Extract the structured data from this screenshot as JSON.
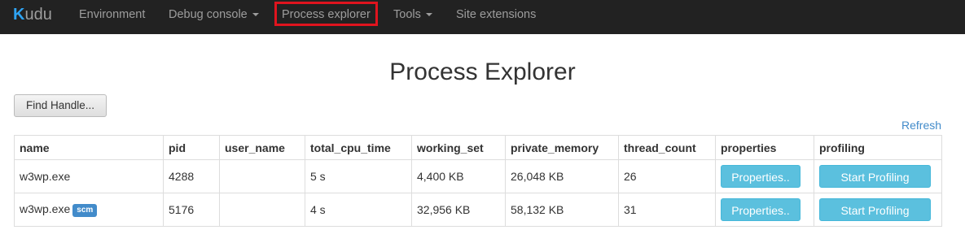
{
  "navbar": {
    "brand_k": "K",
    "brand_rest": "udu",
    "items": [
      {
        "label": "Environment",
        "dropdown": false
      },
      {
        "label": "Debug console",
        "dropdown": true
      },
      {
        "label": "Process explorer",
        "dropdown": false,
        "highlighted": true
      },
      {
        "label": "Tools",
        "dropdown": true
      },
      {
        "label": "Site extensions",
        "dropdown": false
      }
    ]
  },
  "page": {
    "title": "Process Explorer",
    "find_handle_label": "Find Handle...",
    "refresh_label": "Refresh"
  },
  "table": {
    "columns": [
      "name",
      "pid",
      "user_name",
      "total_cpu_time",
      "working_set",
      "private_memory",
      "thread_count",
      "properties",
      "profiling"
    ],
    "rows": [
      {
        "name": "w3wp.exe",
        "badge": "",
        "pid": "4288",
        "user_name": "",
        "total_cpu_time": "5 s",
        "working_set": "4,400 KB",
        "private_memory": "26,048 KB",
        "thread_count": "26",
        "properties_label": "Properties..",
        "profiling_label": "Start Profiling"
      },
      {
        "name": "w3wp.exe",
        "badge": "scm",
        "pid": "5176",
        "user_name": "",
        "total_cpu_time": "4 s",
        "working_set": "32,956 KB",
        "private_memory": "58,132 KB",
        "thread_count": "31",
        "properties_label": "Properties..",
        "profiling_label": "Start Profiling"
      }
    ]
  },
  "colors": {
    "navbar_bg": "#222222",
    "highlight_border": "#e0141e",
    "info_button": "#5bc0de",
    "link": "#428bca",
    "badge": "#428bca"
  }
}
